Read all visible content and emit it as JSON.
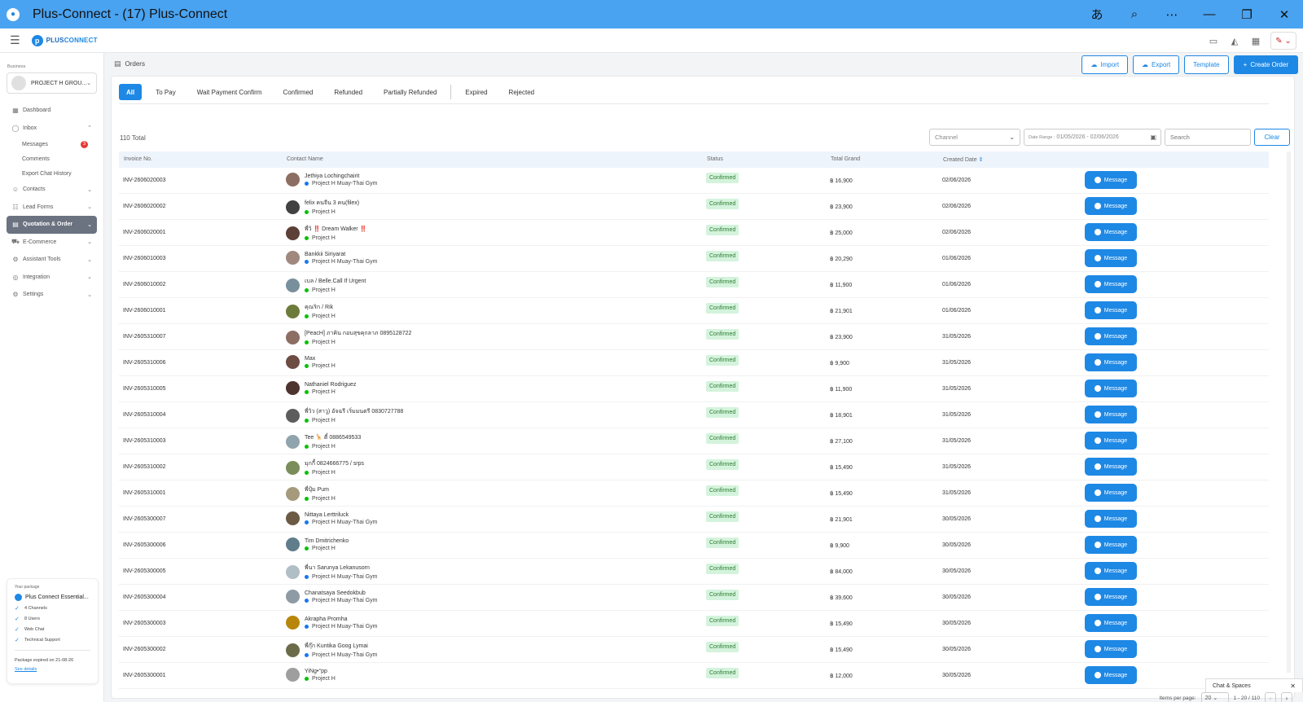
{
  "window": {
    "title": "Plus-Connect - (17) Plus-Connect"
  },
  "header": {
    "logo_main": "PLUS",
    "logo_accent": "CONNECT"
  },
  "sidebar": {
    "business_label": "Business",
    "business_name": "PROJECT H GROU...",
    "nav": [
      {
        "label": "Dashboard",
        "icon": "dashboard-icon"
      },
      {
        "label": "Inbox",
        "icon": "inbox-icon",
        "expanded": true,
        "sub": [
          {
            "label": "Messages",
            "badge": "3"
          },
          {
            "label": "Comments"
          },
          {
            "label": "Export Chat History"
          }
        ]
      },
      {
        "label": "Contacts",
        "icon": "contacts-icon"
      },
      {
        "label": "Lead Forms",
        "icon": "lead-forms-icon"
      },
      {
        "label": "Quotation & Order",
        "icon": "quotation-icon",
        "active": true
      },
      {
        "label": "E-Commerce",
        "icon": "cart-icon"
      },
      {
        "label": "Assistant Tools",
        "icon": "assistant-icon"
      },
      {
        "label": "Integration",
        "icon": "integration-icon"
      },
      {
        "label": "Settings",
        "icon": "gear-icon"
      }
    ],
    "package": {
      "label": "Your package",
      "name": "Plus Connect Essential...",
      "features": [
        "4 Channels",
        "8 Users",
        "Web Chat",
        "Technical Support"
      ],
      "expiry": "Package expired on 21-08-26",
      "link": "See details"
    }
  },
  "main": {
    "page_title": "Orders",
    "actions": {
      "import": "Import",
      "export": "Export",
      "template": "Template",
      "create": "Create Order"
    },
    "tabs": [
      "All",
      "To Pay",
      "Wait Payment Confirm",
      "Confirmed",
      "Refunded",
      "Partially Refunded",
      "Expired",
      "Rejected"
    ],
    "active_tab": "All",
    "total": "110 Total",
    "filters": {
      "channel_placeholder": "Channel",
      "date_label": "Date Range :",
      "date_value": "01/05/2026 - 02/06/2026",
      "search_placeholder": "Search",
      "clear": "Clear"
    },
    "columns": [
      "Invoice No.",
      "Contact Name",
      "Status",
      "Total Grand",
      "Created Date"
    ],
    "sort_indicator": "⇕",
    "message_label": "Message",
    "rows": [
      {
        "invoice": "INV-2606020003",
        "name": "Jethiya Lochingchairit",
        "source": "Project H Muay-Thai Gym",
        "src": "fb",
        "status": "Confirmed",
        "total": "฿ 16,900",
        "date": "02/06/2026",
        "av": "#8d6e63"
      },
      {
        "invoice": "INV-2606020002",
        "name": "felix คนจีน 3 คน(filex)",
        "source": "Project H",
        "src": "line",
        "status": "Confirmed",
        "total": "฿ 23,900",
        "date": "02/06/2026",
        "av": "#424242"
      },
      {
        "invoice": "INV-2606020001",
        "name": "พี่วิ ‼️ Dream Walker ‼️",
        "source": "Project H",
        "src": "line",
        "status": "Confirmed",
        "total": "฿ 25,000",
        "date": "02/06/2026",
        "av": "#5d4037"
      },
      {
        "invoice": "INV-2606010003",
        "name": "Bankkii Siriyarat",
        "source": "Project H Muay-Thai Gym",
        "src": "fb",
        "status": "Confirmed",
        "total": "฿ 20,290",
        "date": "01/06/2026",
        "av": "#a1887f"
      },
      {
        "invoice": "INV-2606010002",
        "name": "เบล / Belle.Call If Urgent",
        "source": "Project H",
        "src": "line",
        "status": "Confirmed",
        "total": "฿ 11,900",
        "date": "01/06/2026",
        "av": "#78909c"
      },
      {
        "invoice": "INV-2606010001",
        "name": "คุณริก / Rik",
        "source": "Project H",
        "src": "line",
        "status": "Confirmed",
        "total": "฿ 21,901",
        "date": "01/06/2026",
        "av": "#6d7b3a"
      },
      {
        "invoice": "INV-2605310007",
        "name": "[PeacH] ภาคิน กอบสุขคุกลาภ 0895128722",
        "source": "Project H",
        "src": "line",
        "status": "Confirmed",
        "total": "฿ 23,900",
        "date": "31/05/2026",
        "av": "#8d6e63"
      },
      {
        "invoice": "INV-2605310006",
        "name": "Max",
        "source": "Project H",
        "src": "line",
        "status": "Confirmed",
        "total": "฿ 9,900",
        "date": "31/05/2026",
        "av": "#6d4c41"
      },
      {
        "invoice": "INV-2605310005",
        "name": "Nathaniel Rodriguez",
        "source": "Project H",
        "src": "line",
        "status": "Confirmed",
        "total": "฿ 11,900",
        "date": "31/05/2026",
        "av": "#4e342e"
      },
      {
        "invoice": "INV-2605310004",
        "name": "พี่วิว (สาวู) อัจฉรี เริ่มมนตรี 0830727788",
        "source": "Project H",
        "src": "line",
        "status": "Confirmed",
        "total": "฿ 18,901",
        "date": "31/05/2026",
        "av": "#5d5d5d"
      },
      {
        "invoice": "INV-2605310003",
        "name": "Tee 🦒 ตี๋ 0886549533",
        "source": "Project H",
        "src": "line",
        "status": "Confirmed",
        "total": "฿ 27,100",
        "date": "31/05/2026",
        "av": "#90a4ae"
      },
      {
        "invoice": "INV-2605310002",
        "name": "มุกกี้ 0824666775 / srps",
        "source": "Project H",
        "src": "line",
        "status": "Confirmed",
        "total": "฿ 15,490",
        "date": "31/05/2026",
        "av": "#7b8d5a"
      },
      {
        "invoice": "INV-2605310001",
        "name": "พี่ปุ้ม Pum",
        "source": "Project H",
        "src": "line",
        "status": "Confirmed",
        "total": "฿ 15,490",
        "date": "31/05/2026",
        "av": "#a59a7c"
      },
      {
        "invoice": "INV-2605300007",
        "name": "Nittaya Lerttriluck",
        "source": "Project H Muay-Thai Gym",
        "src": "fb",
        "status": "Confirmed",
        "total": "฿ 21,901",
        "date": "30/05/2026",
        "av": "#6d5a45"
      },
      {
        "invoice": "INV-2605300006",
        "name": "Tim Dmitrichenko",
        "source": "Project H",
        "src": "line",
        "status": "Confirmed",
        "total": "฿ 9,900",
        "date": "30/05/2026",
        "av": "#607d8b"
      },
      {
        "invoice": "INV-2605300005",
        "name": "พี่นา Sarunya Lekanusorn",
        "source": "Project H Muay-Thai Gym",
        "src": "fb",
        "status": "Confirmed",
        "total": "฿ 84,000",
        "date": "30/05/2026",
        "av": "#b0bec5"
      },
      {
        "invoice": "INV-2605300004",
        "name": "Chanatsaya Seedokbub",
        "source": "Project H Muay-Thai Gym",
        "src": "fb",
        "status": "Confirmed",
        "total": "฿ 39,600",
        "date": "30/05/2026",
        "av": "#8e9ba5"
      },
      {
        "invoice": "INV-2605300003",
        "name": "Akrapha Promha",
        "source": "Project H Muay-Thai Gym",
        "src": "fb",
        "status": "Confirmed",
        "total": "฿ 15,490",
        "date": "30/05/2026",
        "av": "#b8860b"
      },
      {
        "invoice": "INV-2605300002",
        "name": "พี่กุ๊ก Kuntika Goog Lymai",
        "source": "Project H Muay-Thai Gym",
        "src": "fb",
        "status": "Confirmed",
        "total": "฿ 15,490",
        "date": "30/05/2026",
        "av": "#6b6b4a"
      },
      {
        "invoice": "INV-2605300001",
        "name": "YiNg•°pp",
        "source": "Project H",
        "src": "line",
        "status": "Confirmed",
        "total": "฿ 12,000",
        "date": "30/05/2026",
        "av": "#9e9e9e"
      }
    ],
    "pagination": {
      "label": "Items per page:",
      "size": "20",
      "range": "1 - 20 / 110"
    }
  },
  "chat_tab": {
    "label": "Chat & Spaces"
  },
  "colors": {
    "brand": "#1e88e5",
    "titlebar": "#4aa3f0",
    "status_bg": "#d4f3dc",
    "status_fg": "#2e7d32",
    "line": "#00c300",
    "facebook": "#1877f2"
  }
}
